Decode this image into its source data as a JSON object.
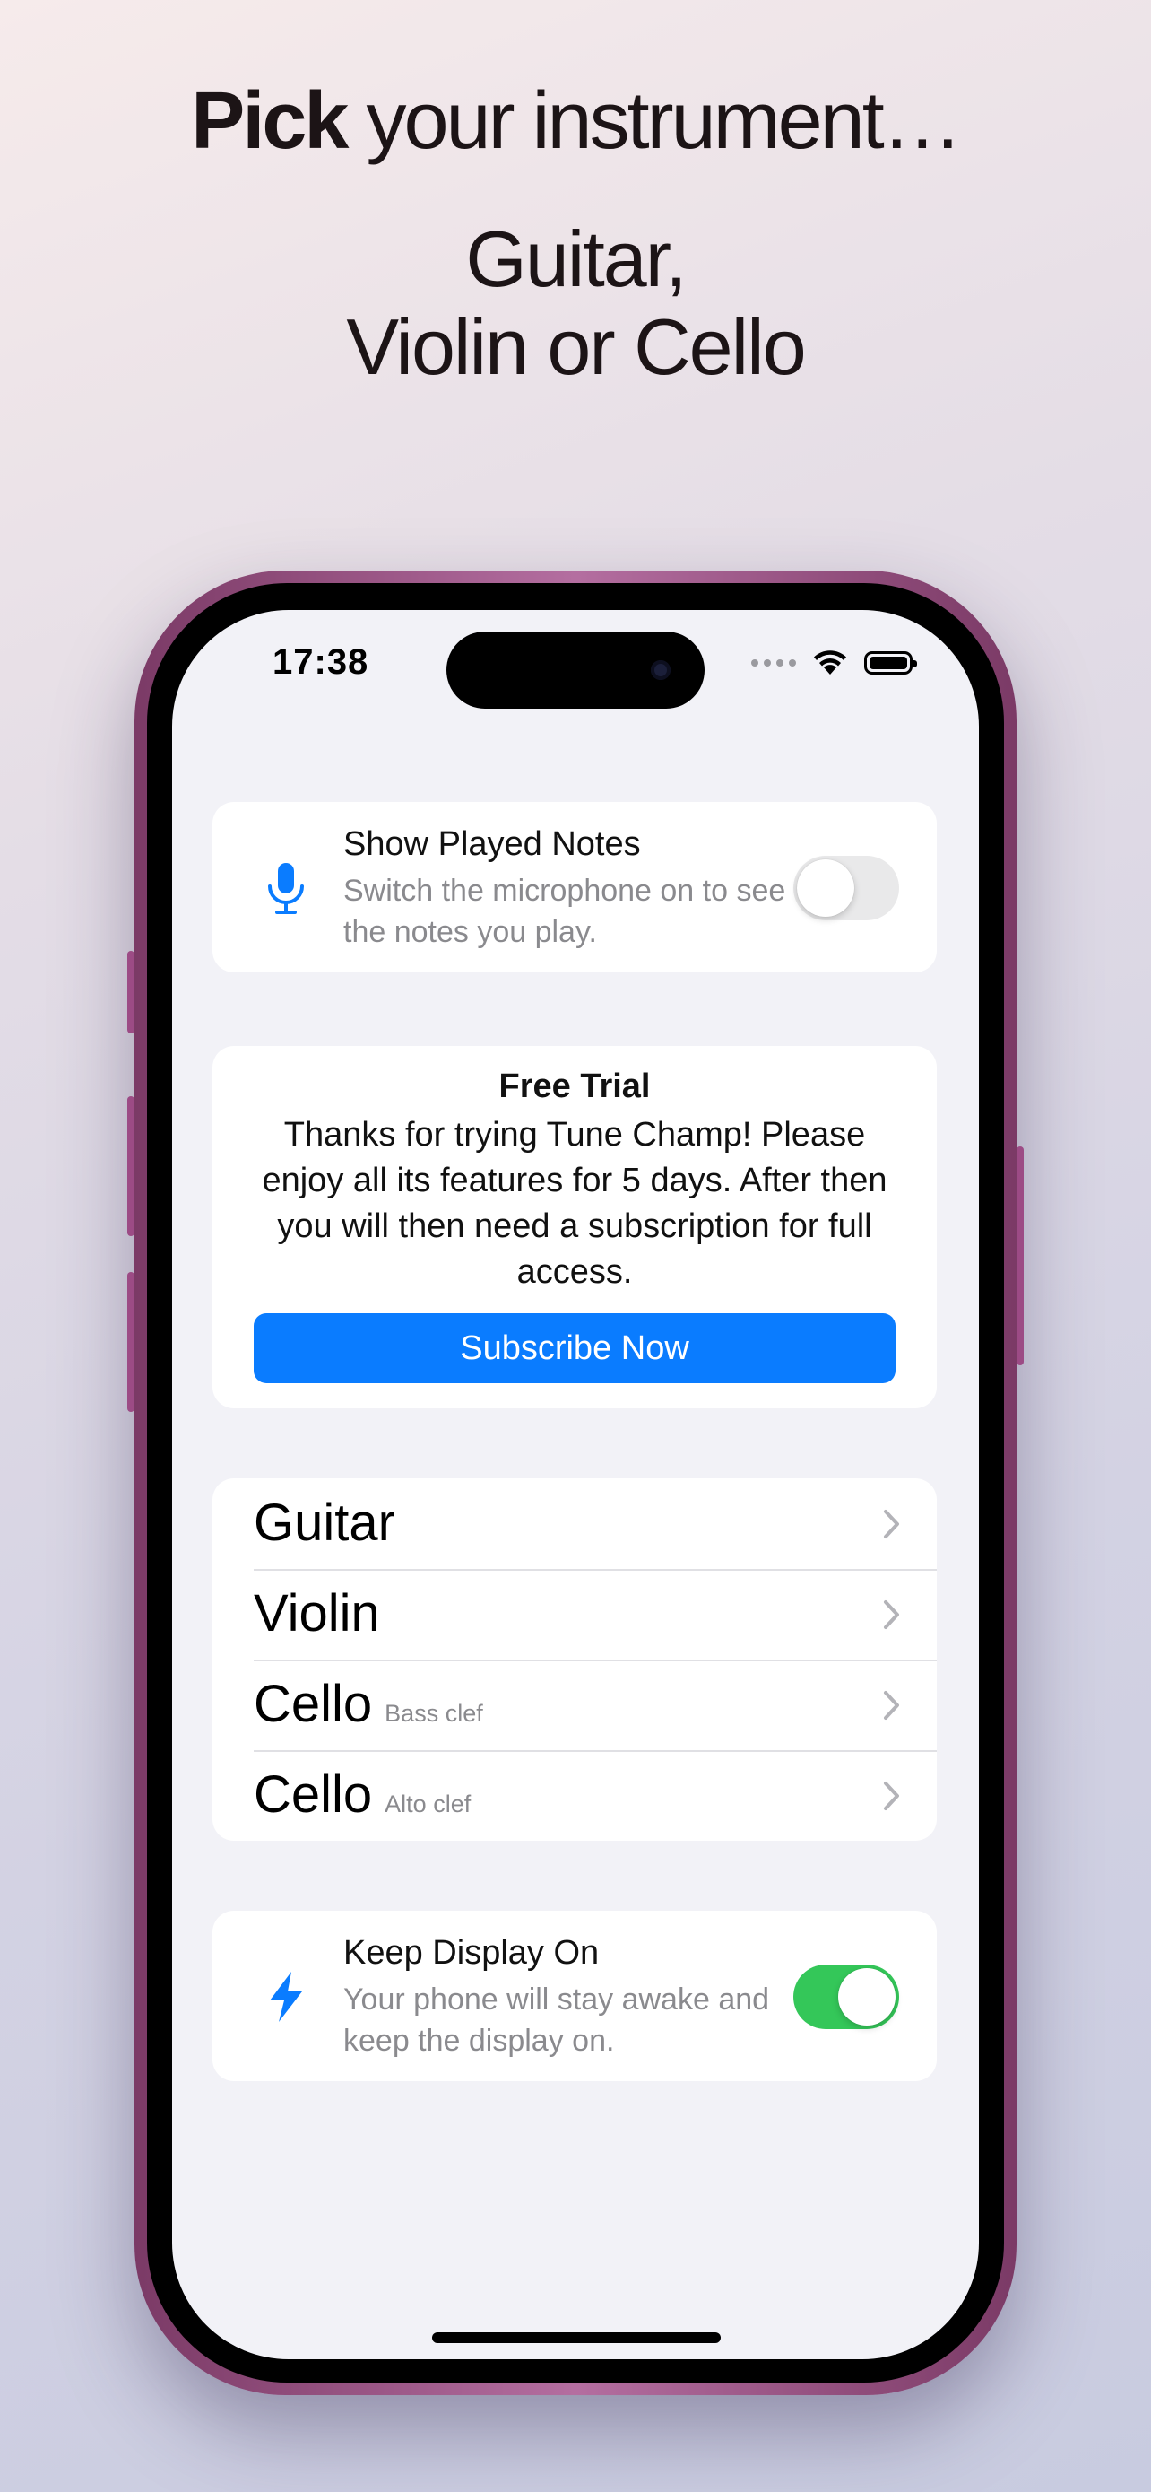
{
  "headline": {
    "bold": "Pick",
    "rest": " your instrument…"
  },
  "subhead": {
    "line1": "Guitar,",
    "line2": "Violin or Cello"
  },
  "status_bar": {
    "time": "17:38"
  },
  "show_notes": {
    "title": "Show Played Notes",
    "subtitle": "Switch the microphone on to see the notes you play.",
    "icon": "microphone-icon",
    "enabled": false
  },
  "trial": {
    "title": "Free Trial",
    "body": "Thanks for trying Tune Champ! Please enjoy all its features for 5 days. After then you will then need a subscription for full access.",
    "button": "Subscribe Now"
  },
  "instruments": [
    {
      "name": "Guitar",
      "clef": ""
    },
    {
      "name": "Violin",
      "clef": ""
    },
    {
      "name": "Cello",
      "clef": "Bass clef"
    },
    {
      "name": "Cello",
      "clef": "Alto clef"
    }
  ],
  "keep_display": {
    "title": "Keep Display On",
    "subtitle": "Your phone will stay awake and keep the display on.",
    "icon": "lightning-bolt-icon",
    "enabled": true
  },
  "colors": {
    "accent": "#0a7cff",
    "toggle_on": "#34c759",
    "toggle_off": "#e9e9ea",
    "phone_frame": "#9c4b85"
  }
}
